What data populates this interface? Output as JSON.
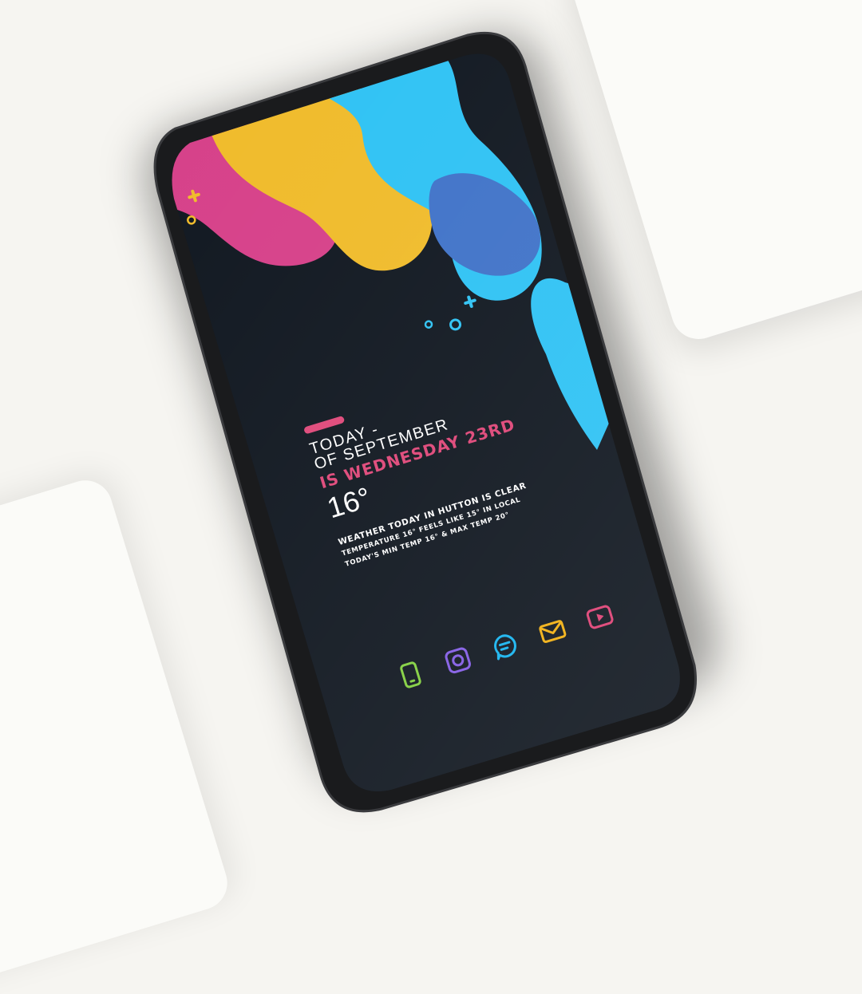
{
  "widget": {
    "line1": "TODAY -",
    "line2": "OF SEPTEMBER",
    "line3": "IS WEDNESDAY 23RD",
    "temperature": "16°",
    "weather_line1": "WEATHER TODAY IN HUTTON IS CLEAR",
    "weather_line2": "TEMPERATURE 16° FEELS LIKE 15° IN LOCAL",
    "weather_line3": "TODAY'S MIN TEMP 16° & MAX TEMP 20°"
  },
  "dock": [
    {
      "name": "phone-icon",
      "color": "#8ad24b"
    },
    {
      "name": "camera-icon",
      "color": "#8b67e6"
    },
    {
      "name": "chat-icon",
      "color": "#27b9f0"
    },
    {
      "name": "mail-icon",
      "color": "#f2b523"
    },
    {
      "name": "youtube-icon",
      "color": "#e0507f"
    }
  ],
  "colors": {
    "screen": "#101720",
    "accent": "#e0507f",
    "magenta": "#d64089",
    "yellow": "#f0bb2a",
    "cyan": "#2ec2f4",
    "blue": "#3f72c8"
  }
}
